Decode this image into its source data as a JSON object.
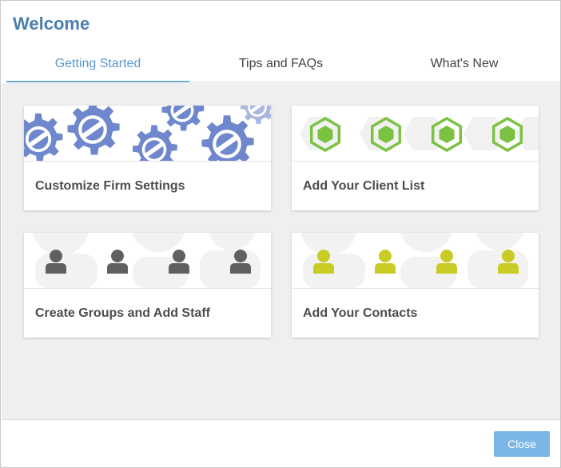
{
  "dialog": {
    "title": "Welcome"
  },
  "tabs": [
    {
      "label": "Getting Started",
      "active": true
    },
    {
      "label": "Tips and FAQs",
      "active": false
    },
    {
      "label": "What's New",
      "active": false
    }
  ],
  "cards": [
    {
      "label": "Customize Firm Settings",
      "icon": "gear-icon"
    },
    {
      "label": "Add Your Client List",
      "icon": "hexagon-icon"
    },
    {
      "label": "Create Groups and Add Staff",
      "icon": "person-icon"
    },
    {
      "label": "Add Your Contacts",
      "icon": "person-icon"
    }
  ],
  "footer": {
    "close_label": "Close"
  },
  "colors": {
    "title": "#4a7fb0",
    "tab_active": "#5a98cc",
    "gear": "#6f87cc",
    "hexagon": "#7cc242",
    "staff_person": "#606060",
    "contact_person": "#c9cc25",
    "close_button": "#7bb6e6"
  }
}
